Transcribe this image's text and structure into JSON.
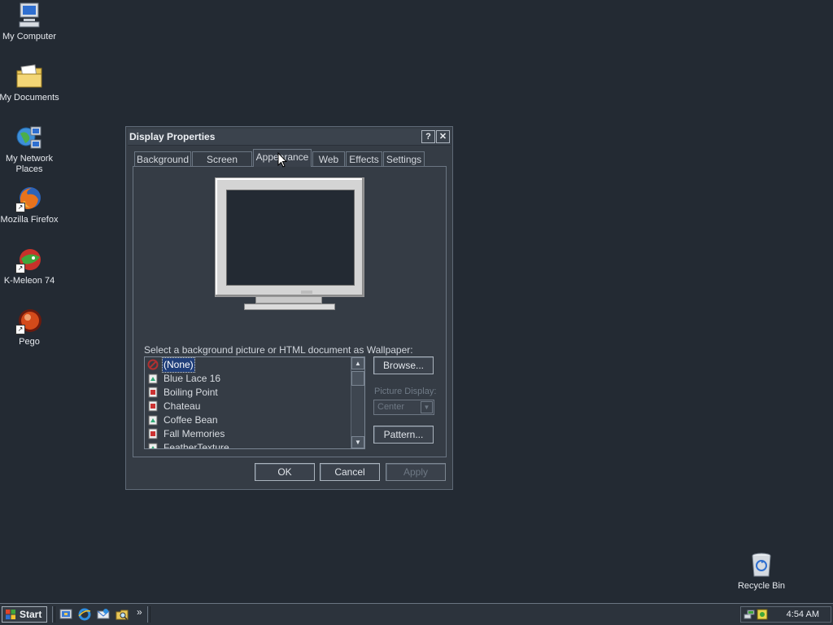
{
  "desktop": {
    "icons": [
      {
        "label": "My Computer",
        "icon": "computer-icon"
      },
      {
        "label": "My Documents",
        "icon": "folder-documents-icon"
      },
      {
        "label": "My Network Places",
        "icon": "network-places-icon"
      },
      {
        "label": "Mozilla Firefox",
        "icon": "firefox-icon"
      },
      {
        "label": "K-Meleon 74",
        "icon": "k-meleon-icon"
      },
      {
        "label": "Pego",
        "icon": "pego-icon"
      },
      {
        "label": "Recycle Bin",
        "icon": "recycle-bin-icon"
      }
    ]
  },
  "dialog": {
    "title": "Display Properties",
    "help_button": "?",
    "close_button": "✕",
    "tabs": [
      {
        "label": "Background"
      },
      {
        "label": "Screen Saver"
      },
      {
        "label": "Appearance"
      },
      {
        "label": "Web"
      },
      {
        "label": "Effects"
      },
      {
        "label": "Settings"
      }
    ],
    "active_tab": "Appearance",
    "wallpaper_label": "Select a background picture or HTML document as Wallpaper:",
    "wallpapers": [
      {
        "label": "(None)",
        "selected": true
      },
      {
        "label": "Blue Lace 16"
      },
      {
        "label": "Boiling Point"
      },
      {
        "label": "Chateau"
      },
      {
        "label": "Coffee Bean"
      },
      {
        "label": "Fall Memories"
      },
      {
        "label": "FeatherTexture"
      }
    ],
    "browse_button": "Browse...",
    "picture_display_label": "Picture Display:",
    "picture_display_value": "Center",
    "pattern_button": "Pattern...",
    "ok_button": "OK",
    "cancel_button": "Cancel",
    "apply_button": "Apply"
  },
  "taskbar": {
    "start_label": "Start",
    "overflow": "»",
    "clock": "4:54 AM"
  },
  "colors": {
    "desktop": "#232a33",
    "selection": "#1f3e79"
  }
}
